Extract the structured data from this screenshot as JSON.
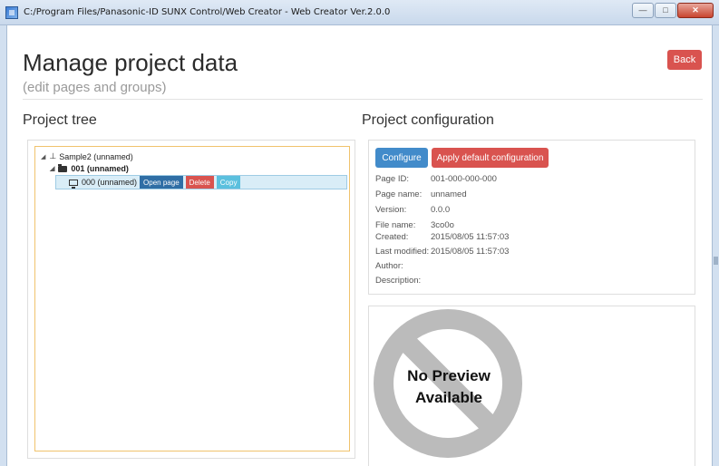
{
  "window": {
    "title": "C:/Program Files/Panasonic-ID SUNX Control/Web Creator - Web Creator Ver.2.0.0"
  },
  "header": {
    "title": "Manage project data",
    "subtitle": "(edit pages and groups)",
    "back_label": "Back"
  },
  "tree": {
    "section_title": "Project tree",
    "root_label": "Sample2 (unnamed)",
    "group_label": "001 (unnamed)",
    "page_label": "000 (unnamed)",
    "open_label": "Open page",
    "delete_label": "Delete",
    "copy_label": "Copy"
  },
  "config": {
    "section_title": "Project configuration",
    "configure_label": "Configure",
    "apply_label": "Apply default configuration",
    "rows": [
      {
        "key": "Page ID:",
        "value": "001-000-000-000"
      },
      {
        "key": "Page name:",
        "value": "unnamed"
      },
      {
        "key": "Version:",
        "value": "0.0.0"
      },
      {
        "key": "File name:",
        "value": "3co0o"
      },
      {
        "key": "Created:",
        "value": "2015/08/05 11:57:03"
      },
      {
        "key": "Last modified:",
        "value": "2015/08/05 11:57:03"
      },
      {
        "key": "Author:",
        "value": ""
      },
      {
        "key": "Description:",
        "value": ""
      }
    ]
  },
  "preview": {
    "line1": "No Preview",
    "line2": "Available"
  },
  "icons": {
    "root": "sitemap-icon",
    "group": "folder-icon",
    "page": "monitor-icon",
    "preview": "no-symbol-icon"
  },
  "colors": {
    "danger": "#d9534f",
    "primary": "#428bca",
    "info": "#5bc0de",
    "highlight_border": "#f0c36d"
  }
}
